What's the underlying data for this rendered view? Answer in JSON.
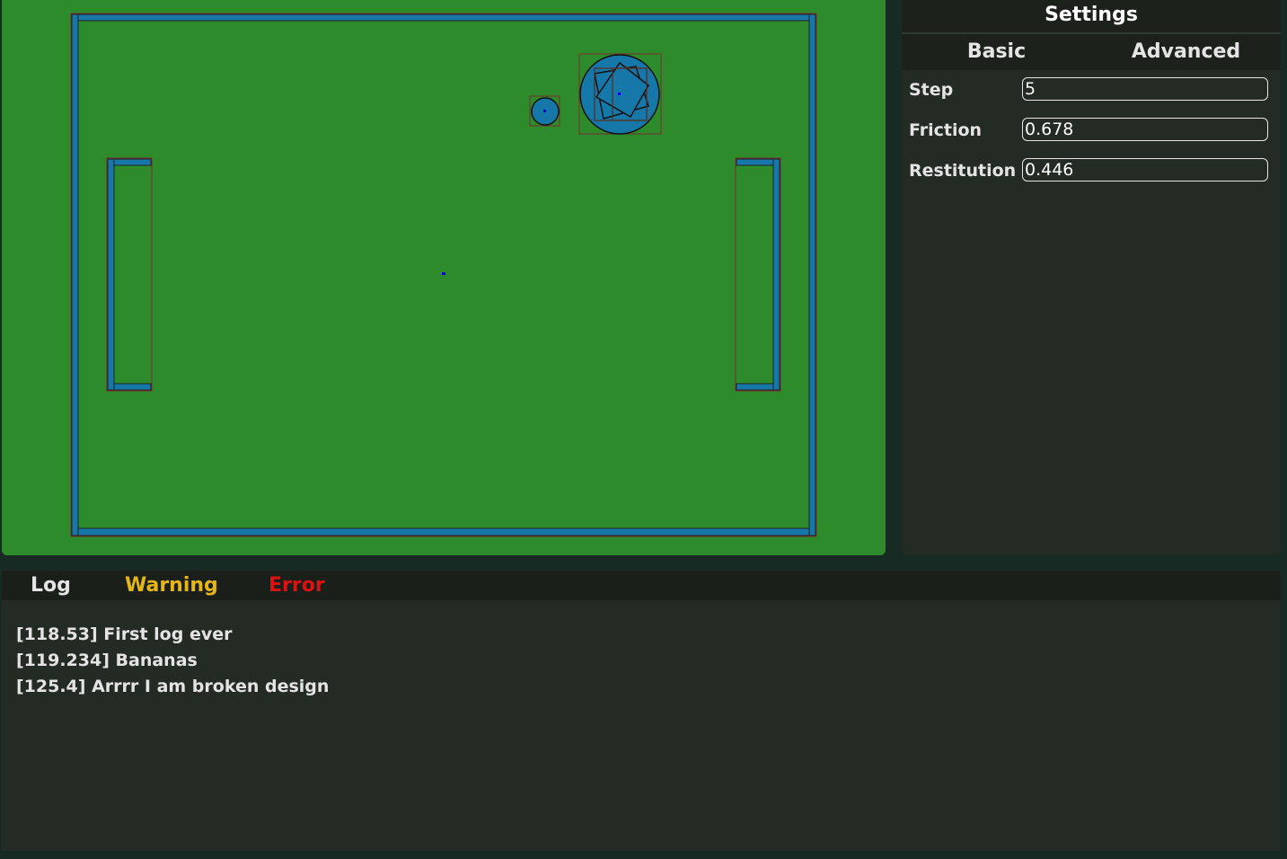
{
  "settings": {
    "title": "Settings",
    "tabs": [
      {
        "label": "Basic"
      },
      {
        "label": "Advanced"
      }
    ],
    "fields": [
      {
        "label": "Step",
        "value": "5"
      },
      {
        "label": "Friction",
        "value": "0.678"
      },
      {
        "label": "Restitution",
        "value": "0.446"
      }
    ]
  },
  "console": {
    "tabs": [
      {
        "label": "Log",
        "color": "#e4e4e4"
      },
      {
        "label": "Warning",
        "color": "#e6b619"
      },
      {
        "label": "Error",
        "color": "#dd1111"
      }
    ],
    "lines": [
      "[118.53] First log ever",
      "[119.234] Bananas",
      "[125.4] Arrrr I am broken design"
    ]
  },
  "colors": {
    "field": "#2e8b2c",
    "body_fill": "#1677a9",
    "outline": "#7a2e2e",
    "center_marker": "#0000ee",
    "panel_bg": "#242a24",
    "panel_header": "#1d211c",
    "app_bg": "#182a24"
  }
}
